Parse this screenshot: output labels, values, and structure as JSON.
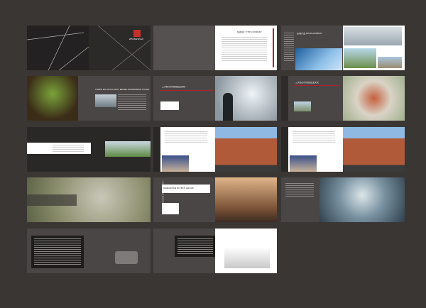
{
  "spreads": [
    {
      "title": "",
      "logo": "ZHONGSHAN"
    },
    {
      "title": "集团简介 THE COMPANY"
    },
    {
      "title": "区域开发 DEVELOPMENT"
    },
    {
      "title": "THREE BIG HIGH-TECH BRAND ENTERPRISE CULTURE"
    },
    {
      "title": "三大核心价值观企业文化"
    },
    {
      "title": "三大核心价值观企业文化"
    },
    {
      "title": ""
    },
    {
      "title": ""
    },
    {
      "title": ""
    },
    {
      "title": ""
    },
    {
      "title": "XIANGSHAN HI-TECH GROUP",
      "sub": "ZHONGSHAN HI-TECH GROUP"
    },
    {
      "title": ""
    },
    {
      "title": ""
    },
    {
      "title": ""
    }
  ],
  "colors": {
    "background": "#3a3634",
    "accent_red": "#b2202a",
    "page_gray": "#4a4645"
  }
}
